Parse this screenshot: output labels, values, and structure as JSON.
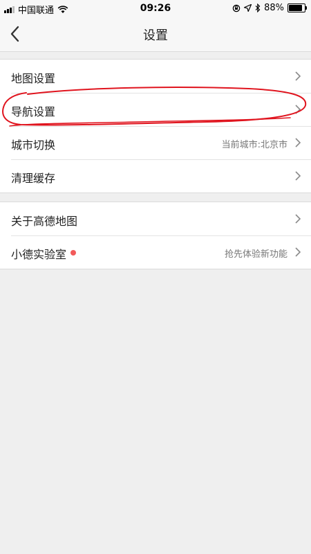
{
  "status_bar": {
    "carrier": "中国联通",
    "time": "09:26",
    "battery": "88%",
    "battery_level": 0.88,
    "signal_icon": "cellular-signal-icon",
    "wifi_icon": "wifi-icon",
    "rotation_lock_icon": "rotation-lock-icon",
    "location_icon": "location-arrow-icon",
    "bluetooth_icon": "bluetooth-icon"
  },
  "nav": {
    "title": "设置",
    "back_icon": "chevron-left-icon"
  },
  "groups": [
    {
      "items": [
        {
          "label": "地图设置",
          "value": ""
        },
        {
          "label": "导航设置",
          "value": ""
        },
        {
          "label": "城市切换",
          "value": "当前城市:北京市"
        },
        {
          "label": "清理缓存",
          "value": ""
        }
      ]
    },
    {
      "items": [
        {
          "label": "关于高德地图",
          "value": ""
        },
        {
          "label": "小德实验室",
          "value": "抢先体验新功能",
          "badge": "red-dot"
        }
      ]
    }
  ],
  "annotation": {
    "color": "#e0141e",
    "target": "导航设置"
  }
}
